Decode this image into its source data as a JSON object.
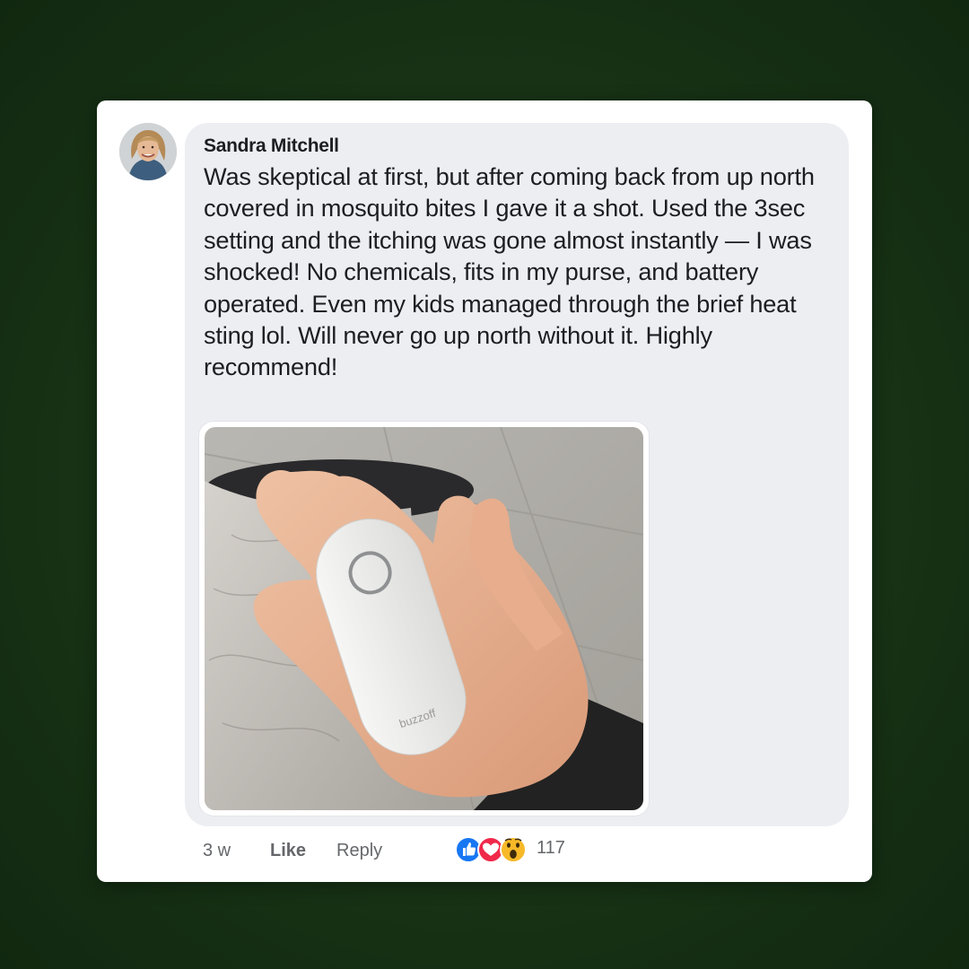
{
  "post": {
    "author": "Sandra Mitchell",
    "body": "Was skeptical at first, but after coming back from up north covered in mosquito bites I gave it a shot. Used the 3sec setting and the itching was gone almost instantly — I was shocked! No chemicals, fits in my purse, and battery operated. Even my kids managed through the brief heat sting lol. Will never go up north without it. Highly recommend!",
    "photo": {
      "description_icon": "product-photo",
      "device_brand": "buzzoff"
    }
  },
  "actions": {
    "time": "3 w",
    "like_label": "Like",
    "reply_label": "Reply",
    "reaction_icons": [
      "like-icon",
      "love-icon",
      "wow-icon"
    ],
    "reaction_count": "117"
  },
  "colors": {
    "background": "#173215",
    "bubble": "#eceef2",
    "like_blue": "#1877f2",
    "love_red": "#f0284a",
    "wow_yellow": "#f7b928"
  }
}
